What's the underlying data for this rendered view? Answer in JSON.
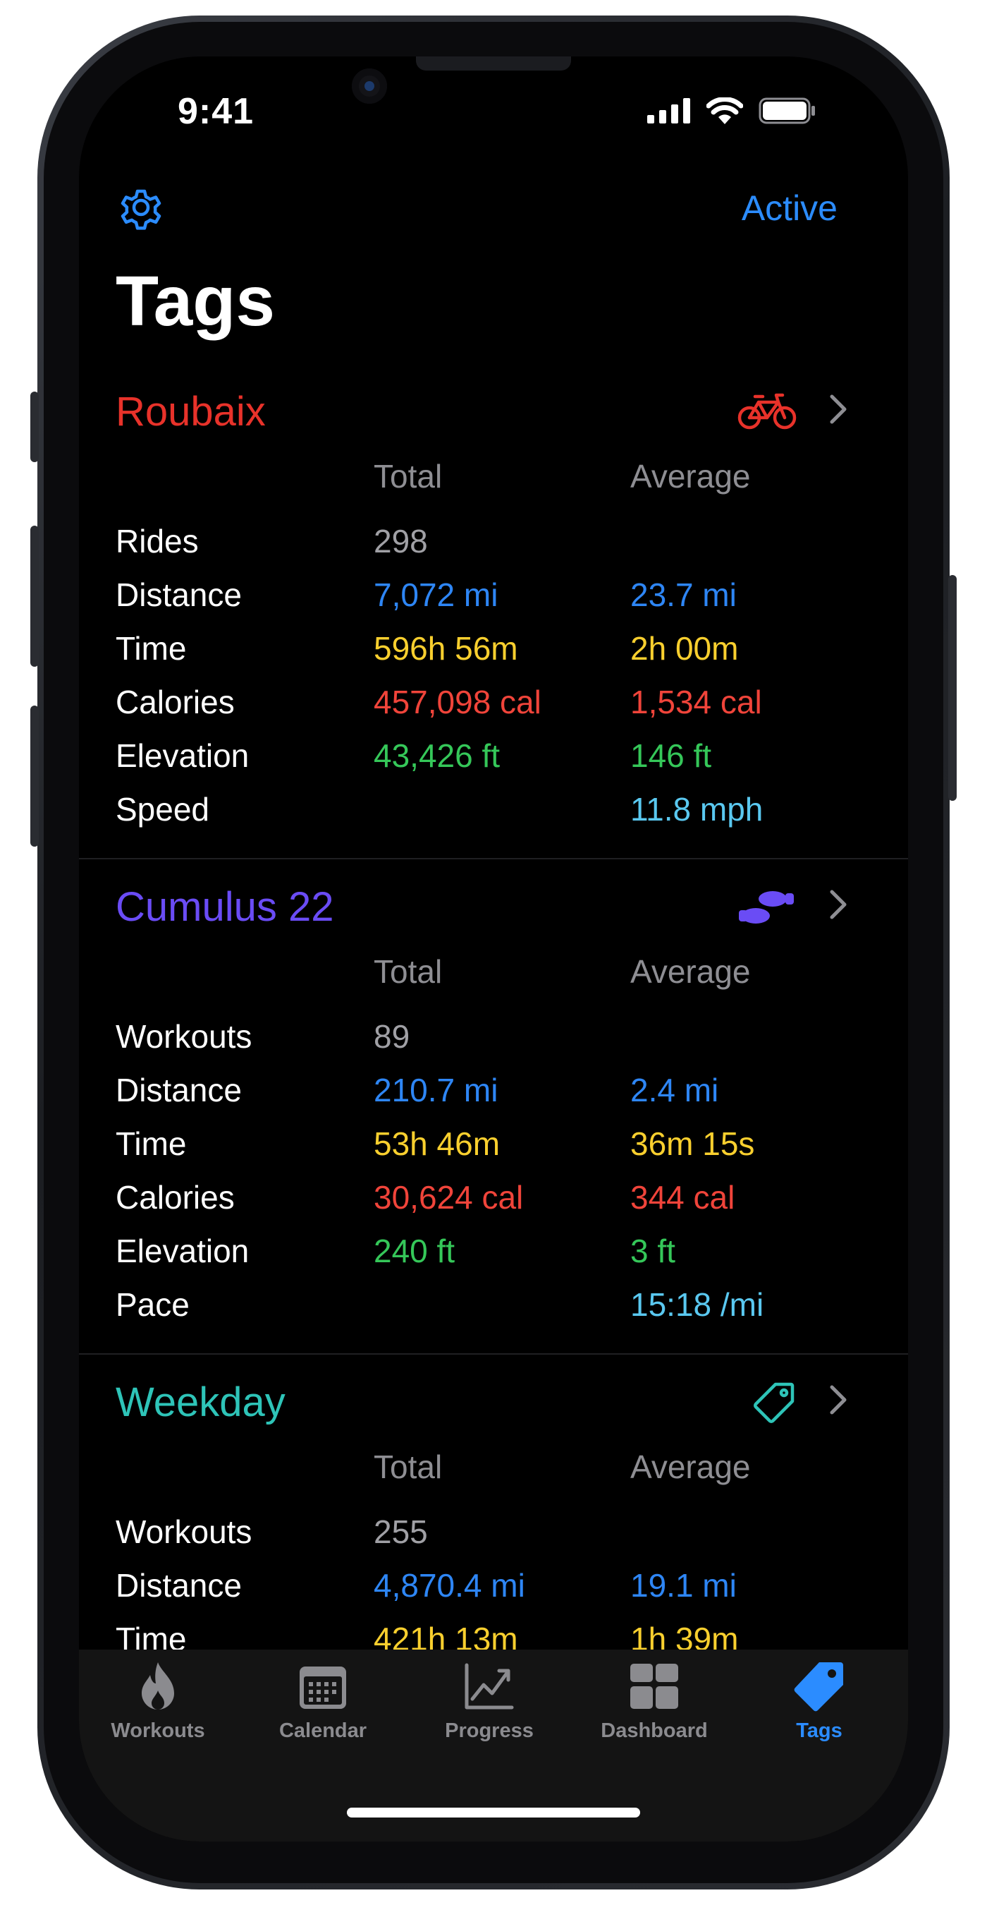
{
  "status": {
    "time": "9:41"
  },
  "nav": {
    "active_label": "Active",
    "title": "Tags"
  },
  "sections": [
    {
      "name": "Roubaix",
      "color": "#e8322a",
      "icon": "bicycle-icon",
      "total_header": "Total",
      "average_header": "Average",
      "rows": [
        {
          "label": "Rides",
          "total": "298",
          "average": ""
        },
        {
          "label": "Distance",
          "total": "7,072 mi",
          "average": "23.7 mi"
        },
        {
          "label": "Time",
          "total": "596h 56m",
          "average": "2h 00m"
        },
        {
          "label": "Calories",
          "total": "457,098 cal",
          "average": "1,534 cal"
        },
        {
          "label": "Elevation",
          "total": "43,426 ft",
          "average": "146 ft"
        },
        {
          "label": "Speed",
          "total": "",
          "average": "11.8 mph"
        }
      ]
    },
    {
      "name": "Cumulus 22",
      "color": "#6a4cf5",
      "icon": "shoe-prints-icon",
      "total_header": "Total",
      "average_header": "Average",
      "rows": [
        {
          "label": "Workouts",
          "total": "89",
          "average": ""
        },
        {
          "label": "Distance",
          "total": "210.7 mi",
          "average": "2.4 mi"
        },
        {
          "label": "Time",
          "total": "53h 46m",
          "average": "36m 15s"
        },
        {
          "label": "Calories",
          "total": "30,624 cal",
          "average": "344 cal"
        },
        {
          "label": "Elevation",
          "total": "240 ft",
          "average": "3 ft"
        },
        {
          "label": "Pace",
          "total": "",
          "average": "15:18 /mi"
        }
      ]
    },
    {
      "name": "Weekday",
      "color": "#2ec4b8",
      "icon": "tag-outline-icon",
      "total_header": "Total",
      "average_header": "Average",
      "rows": [
        {
          "label": "Workouts",
          "total": "255",
          "average": ""
        },
        {
          "label": "Distance",
          "total": "4,870.4 mi",
          "average": "19.1 mi"
        },
        {
          "label": "Time",
          "total": "421h 13m",
          "average": "1h 39m"
        }
      ]
    }
  ],
  "tabbar": [
    {
      "label": "Workouts",
      "icon": "flame-icon"
    },
    {
      "label": "Calendar",
      "icon": "calendar-icon"
    },
    {
      "label": "Progress",
      "icon": "chart-line-icon"
    },
    {
      "label": "Dashboard",
      "icon": "grid-icon"
    },
    {
      "label": "Tags",
      "icon": "tag-icon",
      "selected": true
    }
  ]
}
